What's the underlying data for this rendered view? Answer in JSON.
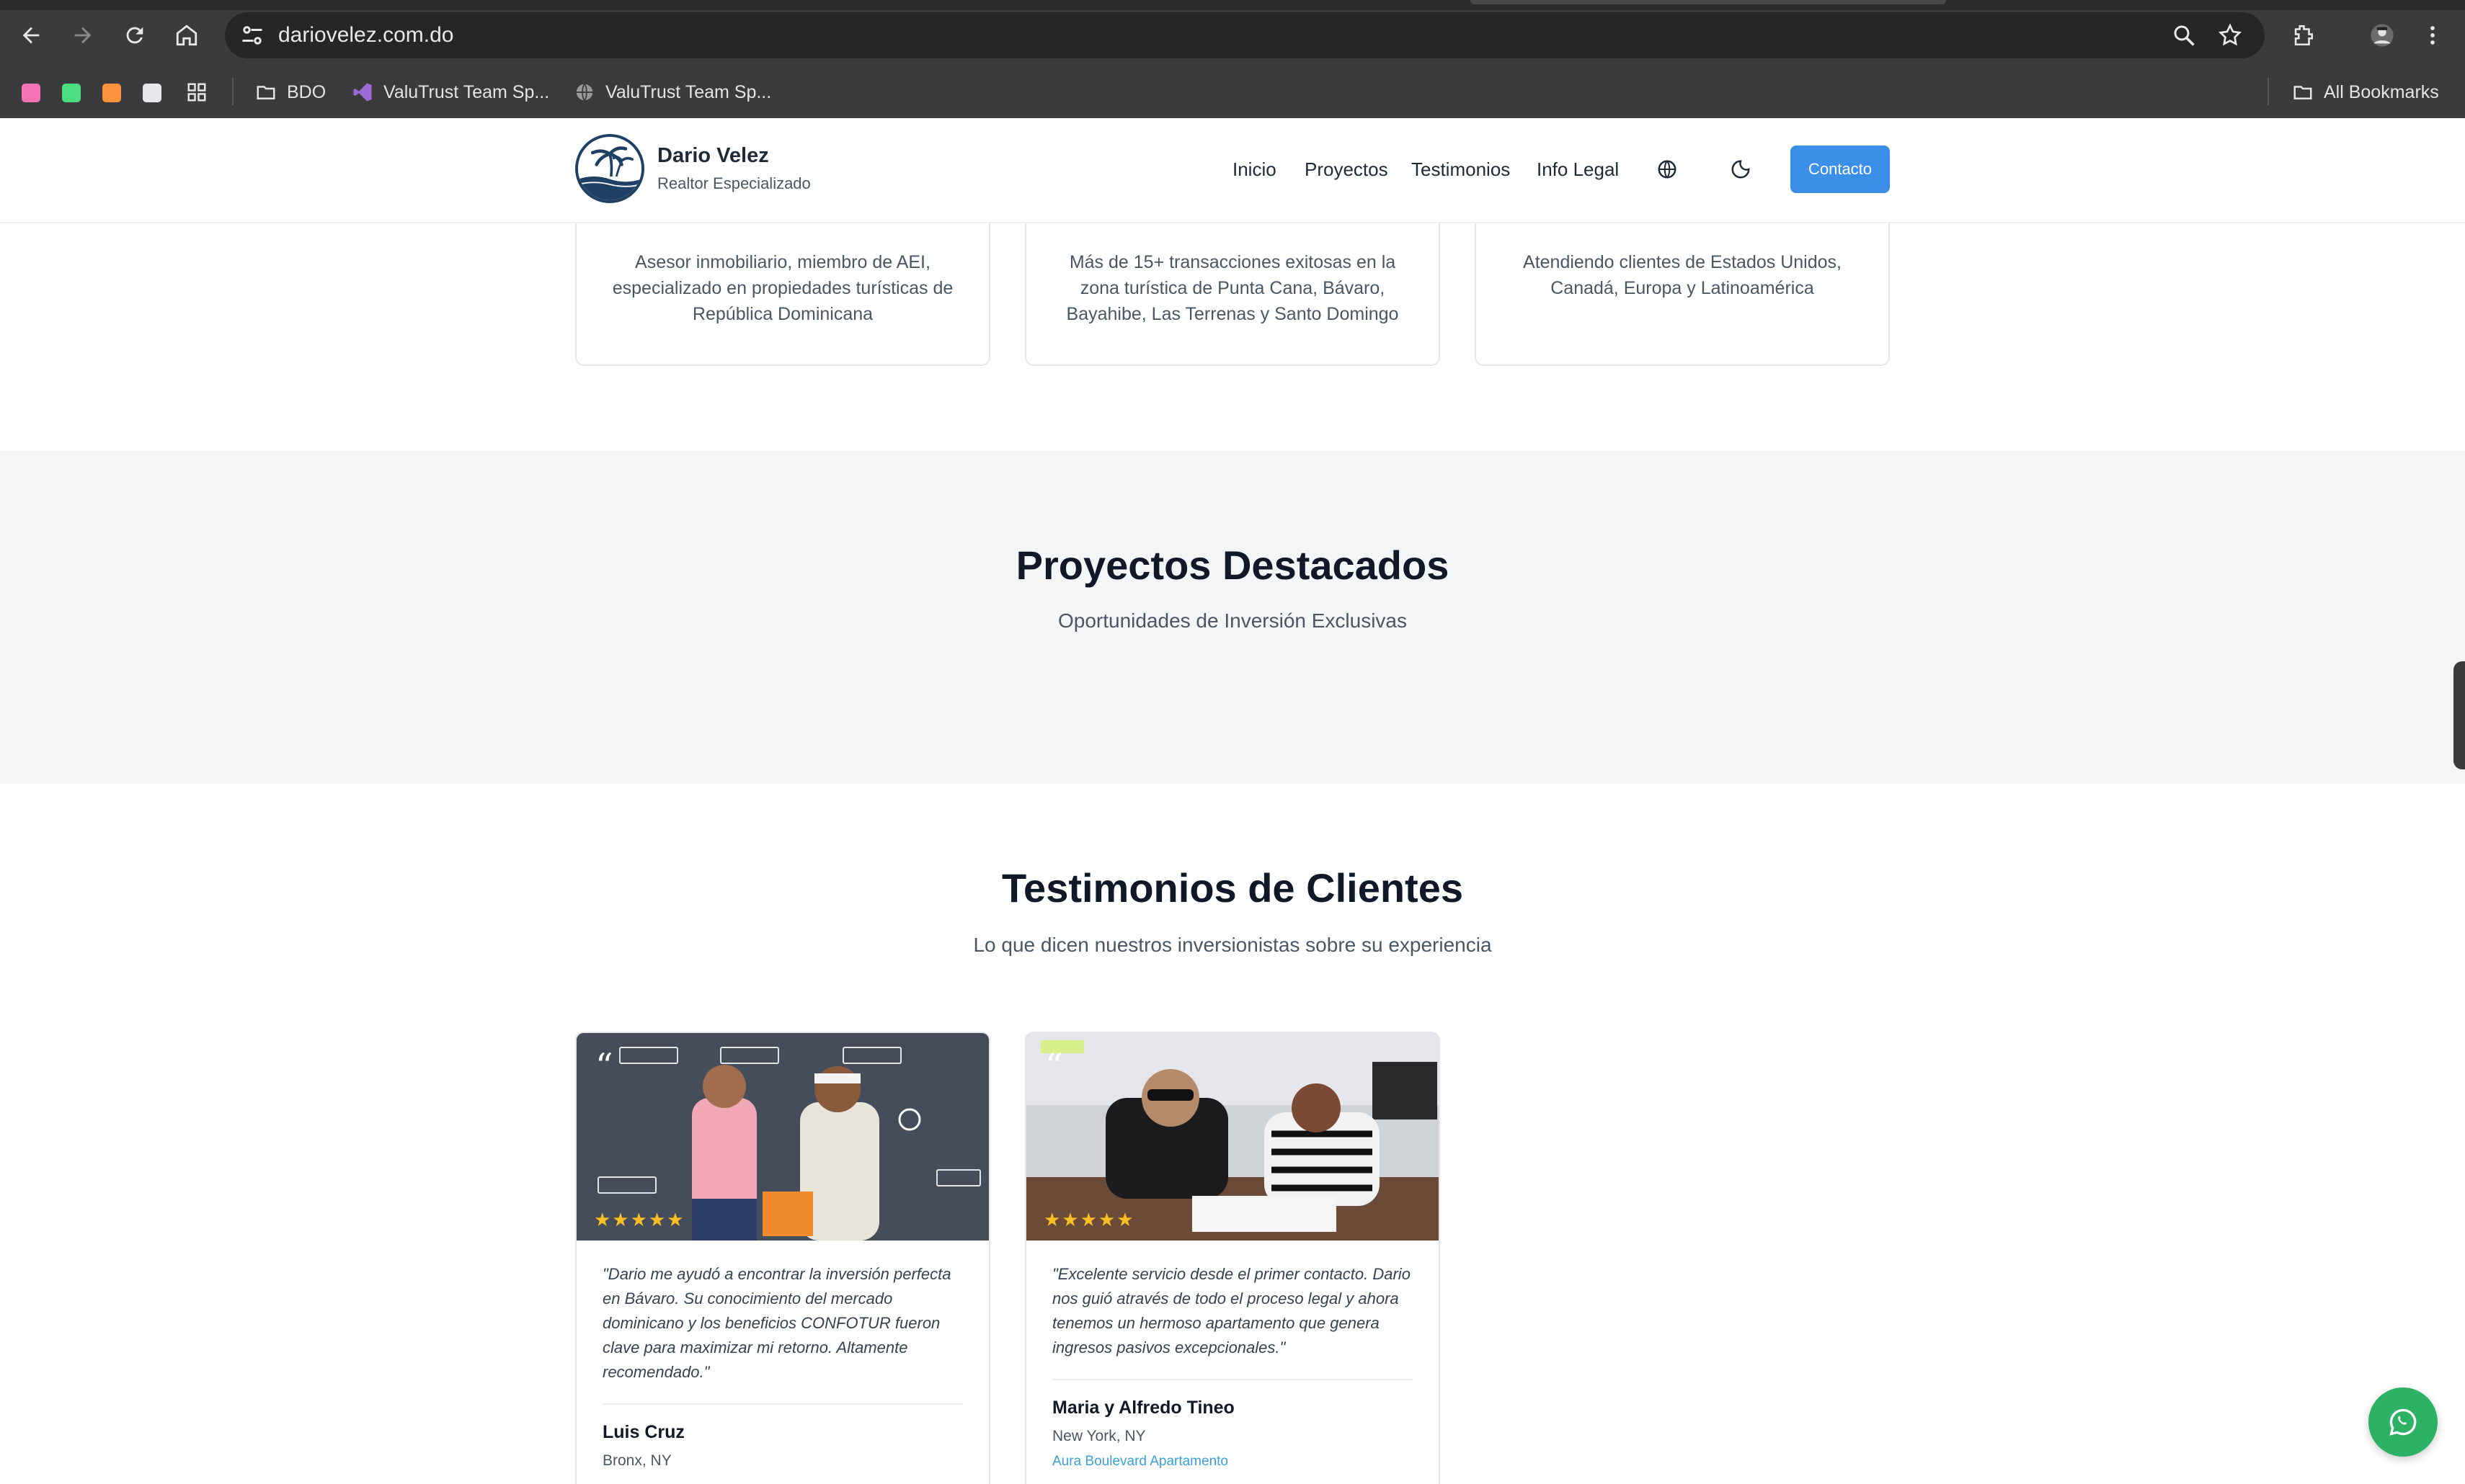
{
  "browser": {
    "url": "dariovelez.com.do",
    "bookmarks": [
      {
        "label": "BDO"
      },
      {
        "label": "ValuTrust Team Sp..."
      },
      {
        "label": "ValuTrust Team Sp..."
      }
    ],
    "all_bookmarks": "All Bookmarks",
    "bookmark_colors": [
      "#f472b6",
      "#4ade80",
      "#fb923c",
      "#e5e7eb"
    ]
  },
  "header": {
    "brand_name": "Dario Velez",
    "brand_sub": "Realtor Especializado",
    "nav": [
      {
        "label": "Inicio"
      },
      {
        "label": "Proyectos"
      },
      {
        "label": "Testimonios"
      },
      {
        "label": "Info Legal"
      }
    ],
    "contact_label": "Contacto",
    "accent": "#3b8fe8"
  },
  "features": [
    {
      "text": "Asesor inmobiliario, miembro de AEI, especializado en propiedades turísticas de República Dominicana"
    },
    {
      "text": "Más de 15+ transacciones exitosas en la zona turística de Punta Cana, Bávaro, Bayahibe, Las Terrenas y Santo Domingo"
    },
    {
      "text": "Atendiendo clientes de Estados Unidos, Canadá, Europa y Latinoamérica"
    }
  ],
  "projects": {
    "title": "Proyectos Destacados",
    "subtitle": "Oportunidades de Inversión Exclusivas"
  },
  "testimonials": {
    "title": "Testimonios de Clientes",
    "subtitle": "Lo que dicen nuestros inversionistas sobre su experiencia",
    "items": [
      {
        "quote": "\"Dario me ayudó a encontrar la inversión perfecta en Bávaro. Su conocimiento del mercado dominicano y los beneficios CONFOTUR fueron clave para maximizar mi retorno. Altamente recomendado.\"",
        "name": "Luis Cruz",
        "location": "Bronx, NY",
        "stars": "★★★★★",
        "rating": 5
      },
      {
        "quote": "\"Excelente servicio desde el primer contacto. Dario nos guió através de todo el proceso legal y ahora tenemos un hermoso apartamento que genera ingresos pasivos excepcionales.\"",
        "name": "Maria y Alfredo Tineo",
        "location": "New York, NY",
        "property": "Aura Boulevard Apartamento",
        "stars": "★★★★★",
        "rating": 5
      }
    ]
  }
}
